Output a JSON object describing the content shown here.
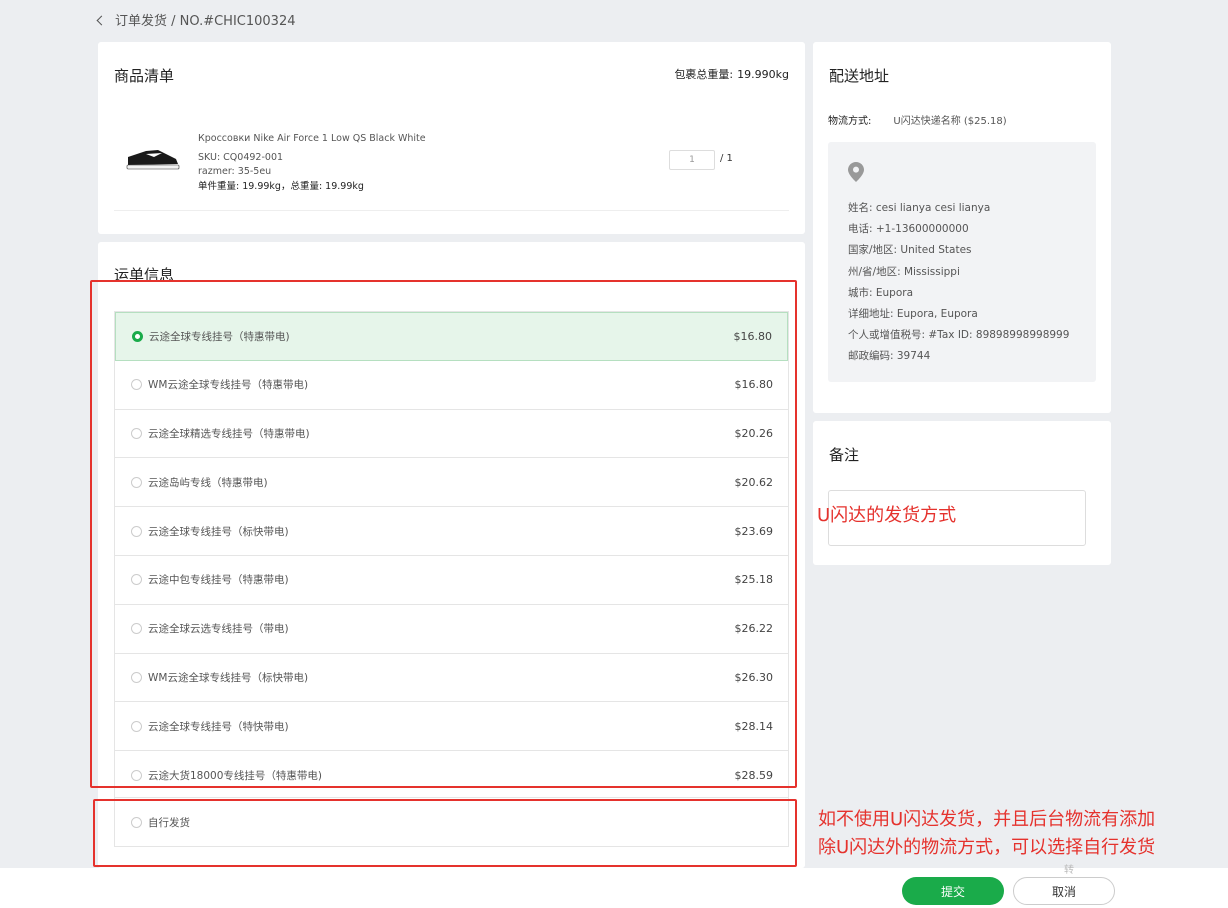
{
  "breadcrumb": {
    "text": "订单发货 / NO.#CHIC100324"
  },
  "products": {
    "title": "商品清单",
    "weight_label": "包裹总重量:",
    "weight_value": "19.990kg",
    "item": {
      "name": "Кроссовки Nike Air Force 1 Low QS Black White",
      "sku": "SKU: CQ0492-001",
      "size": "razmer: 35-5eu",
      "weights": "单件重量: 19.99kg，总重量: 19.99kg",
      "qty": "1",
      "qty_total": "/ 1"
    }
  },
  "shipping": {
    "title": "运单信息",
    "options": [
      {
        "name": "云途全球专线挂号（特惠带电)",
        "price": "$16.80"
      },
      {
        "name": "WM云途全球专线挂号（特惠带电)",
        "price": "$16.80"
      },
      {
        "name": "云途全球精选专线挂号（特惠带电)",
        "price": "$20.26"
      },
      {
        "name": "云途岛屿专线（特惠带电)",
        "price": "$20.62"
      },
      {
        "name": "云途全球专线挂号（标快带电)",
        "price": "$23.69"
      },
      {
        "name": "云途中包专线挂号（特惠带电)",
        "price": "$25.18"
      },
      {
        "name": "云途全球云选专线挂号（带电)",
        "price": "$26.22"
      },
      {
        "name": "WM云途全球专线挂号（标快带电)",
        "price": "$26.30"
      },
      {
        "name": "云途全球专线挂号（特快带电)",
        "price": "$28.14"
      },
      {
        "name": "云途大货18000专线挂号（特惠带电)",
        "price": "$28.59"
      }
    ],
    "selected_index": 0,
    "self_ship_label": "自行发货"
  },
  "address": {
    "title": "配送地址",
    "method_label": "物流方式:",
    "method_value": "U闪达快递名称 ($25.18)",
    "lines": [
      "姓名: cesi lianya cesi lianya",
      "电话: +1-13600000000",
      "国家/地区: United States",
      "州/省/地区: Mississippi",
      "城市: Eupora",
      "详细地址: Eupora, Eupora",
      "个人或增值税号: #Tax ID: 89898998998999",
      "邮政编码: 39744"
    ]
  },
  "notes": {
    "title": "备注"
  },
  "annotations": {
    "method_note": "U闪达的发货方式",
    "self_ship_note_line1": "如不使用U闪达发货，并且后台物流有添加",
    "self_ship_note_line2": "除U闪达外的物流方式，可以选择自行发货"
  },
  "footer": {
    "submit_label": "提交",
    "cancel_label": "取消",
    "faint_text": "转"
  },
  "colors": {
    "accent": "#1aab4a",
    "annotation": "#e5322d",
    "selected_bg": "#e6f5ea"
  }
}
